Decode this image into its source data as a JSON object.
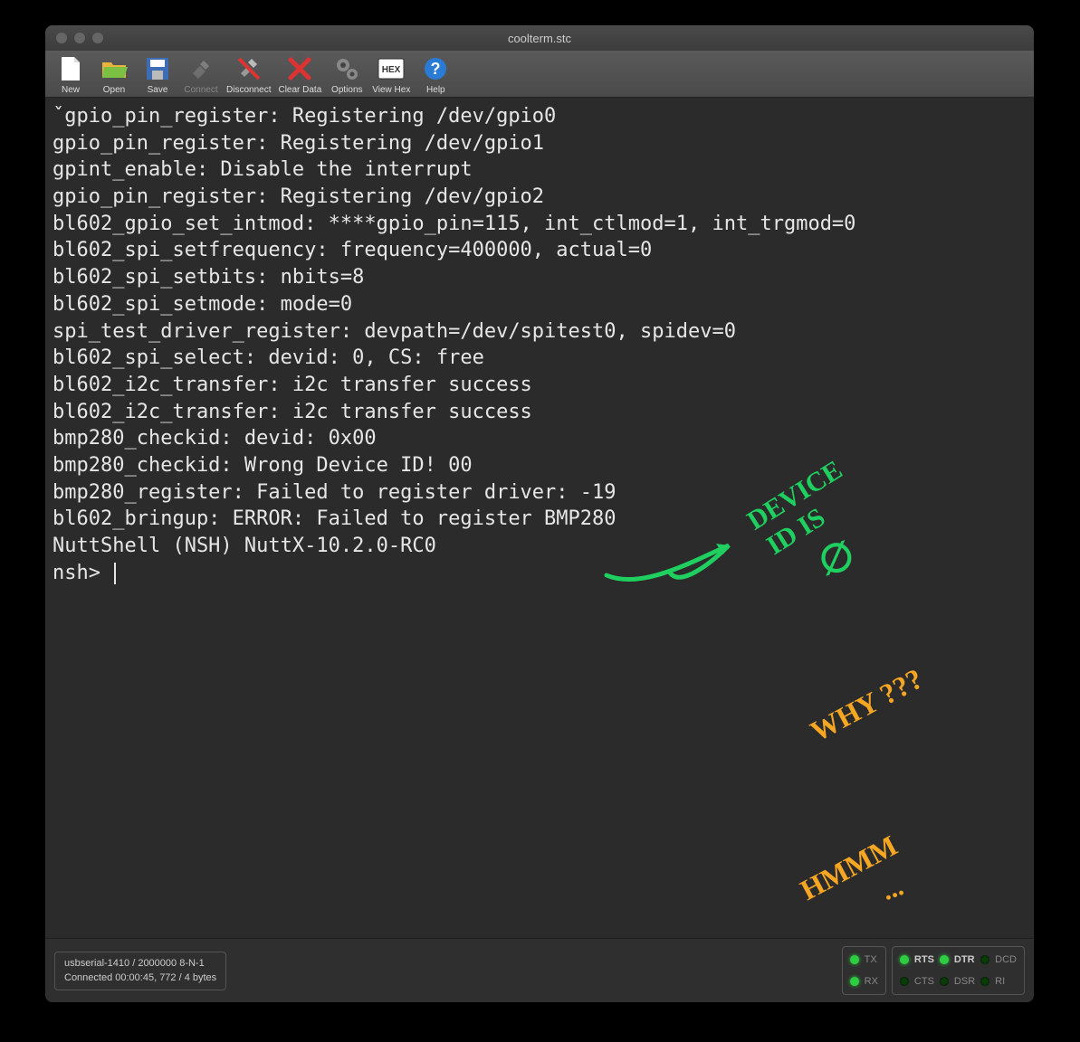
{
  "window": {
    "title": "coolterm.stc"
  },
  "toolbar": {
    "new": "New",
    "open": "Open",
    "save": "Save",
    "connect": "Connect",
    "disconnect": "Disconnect",
    "clear_data": "Clear Data",
    "options": "Options",
    "view_hex": "View Hex",
    "help": "Help"
  },
  "terminal": {
    "lines": [
      "ˇgpio_pin_register: Registering /dev/gpio0",
      "gpio_pin_register: Registering /dev/gpio1",
      "gpint_enable: Disable the interrupt",
      "gpio_pin_register: Registering /dev/gpio2",
      "bl602_gpio_set_intmod: ****gpio_pin=115, int_ctlmod=1, int_trgmod=0",
      "bl602_spi_setfrequency: frequency=400000, actual=0",
      "bl602_spi_setbits: nbits=8",
      "bl602_spi_setmode: mode=0",
      "spi_test_driver_register: devpath=/dev/spitest0, spidev=0",
      "bl602_spi_select: devid: 0, CS: free",
      "bl602_i2c_transfer: i2c transfer success",
      "bl602_i2c_transfer: i2c transfer success",
      "bmp280_checkid: devid: 0x00",
      "bmp280_checkid: Wrong Device ID! 00",
      "bmp280_register: Failed to register driver: -19",
      "bl602_bringup: ERROR: Failed to register BMP280",
      "",
      "NuttShell (NSH) NuttX-10.2.0-RC0",
      "nsh> "
    ]
  },
  "annotations": {
    "green1": "DEVICE",
    "green2": "ID IS",
    "green3": "∅",
    "orange1": "WHY ???",
    "orange2": "HMMM",
    "orange2_dots": "..."
  },
  "status": {
    "port": "usbserial-1410 / 2000000 8-N-1",
    "connection": "Connected 00:00:45, 772 / 4 bytes",
    "leds": {
      "tx": "TX",
      "rx": "RX",
      "rts": "RTS",
      "cts": "CTS",
      "dtr": "DTR",
      "dsr": "DSR",
      "dcd": "DCD",
      "ri": "RI"
    }
  },
  "colors": {
    "annotation_green": "#1fcf5f",
    "annotation_orange": "#f5a623"
  }
}
